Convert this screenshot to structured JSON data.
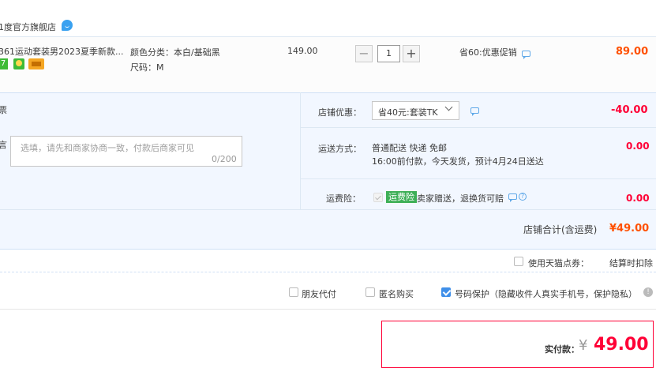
{
  "store": {
    "name": "1度官方旗舰店",
    "wangwang_icon": "wangwang-chat-icon"
  },
  "item": {
    "title": "361运动套装男2023夏季新款...",
    "badge_number": "7",
    "sku_color": "颜色分类：本白/基础黑",
    "sku_size": "尺码：M",
    "unit_price": "149.00",
    "quantity": "1",
    "minus": "−",
    "plus": "+",
    "promo": "省60:优惠促销",
    "subtotal": "89.00"
  },
  "invoice": {
    "label": "票"
  },
  "note": {
    "label": "言",
    "placeholder": "选填，请先和商家协商一致，付款后商家可见",
    "count": "0/200"
  },
  "coupon": {
    "label": "店铺优惠：",
    "selected": "省40元:套装TK",
    "amount": "-40.00"
  },
  "shipping": {
    "label": "运送方式：",
    "method": "普通配送 快递 免邮",
    "detail": "16:00前付款，今天发货，预计4月24日送达",
    "amount": "0.00"
  },
  "insurance": {
    "label": "运费险：",
    "tag": "运费险",
    "text": "卖家赠送，退换货可赔",
    "amount": "0.00"
  },
  "store_total": {
    "label": "店铺合计(含运费)",
    "amount": "¥49.00"
  },
  "tmall_points": {
    "label": "使用天猫点券：",
    "right_text": "结算时扣除"
  },
  "options": {
    "friend_pay": "朋友代付",
    "anonymous": "匿名购买",
    "number_protect": "号码保护（隐藏收件人真实手机号，保护隐私）",
    "info_icon": "!"
  },
  "payment": {
    "label": "实付款：",
    "yen": "¥",
    "amount": "49.00"
  },
  "colors": {
    "accent_red": "#ff0036",
    "accent_orange": "#ff5000",
    "panel_blue": "#f2f7ff"
  }
}
